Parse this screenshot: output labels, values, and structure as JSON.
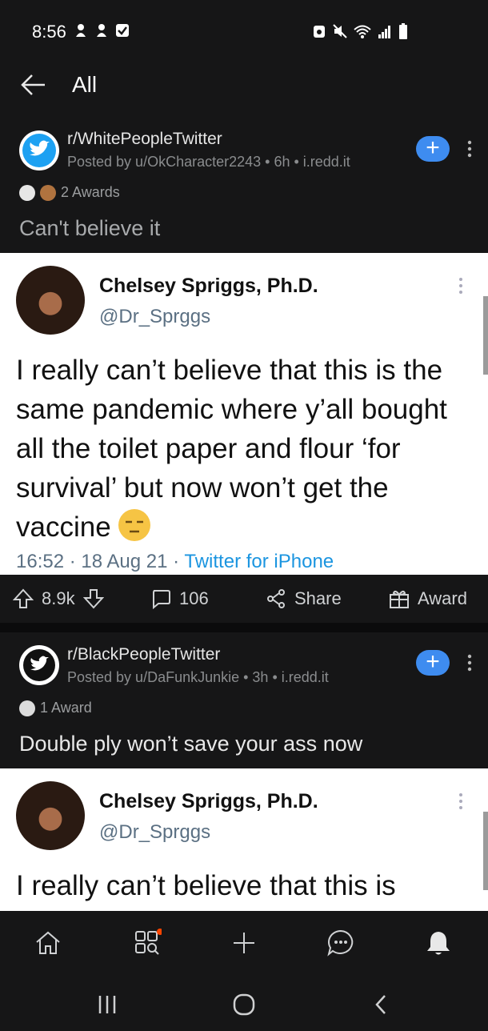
{
  "status_bar": {
    "time": "8:56",
    "left_icons": [
      "notification-app-icon",
      "notification-app-icon",
      "checkbox-notification-icon"
    ],
    "right_icons": [
      "alarm-icon",
      "mute-icon",
      "wifi-icon",
      "signal-icon",
      "battery-icon"
    ]
  },
  "top_nav": {
    "title": "All"
  },
  "posts": [
    {
      "subreddit": "r/WhitePeopleTwitter",
      "posted_by": "Posted by u/OkCharacter2243 • 6h • i.redd.it",
      "awards": "2 Awards",
      "title": "Can't believe it",
      "tweet": {
        "name": "Chelsey Spriggs, Ph.D.",
        "handle": "@Dr_Sprggs",
        "text": "I really can’t believe that this is the same pandemic where y’all bought all the toilet paper and flour ‘for survival’ but now won’t get the vaccine",
        "meta": "16:52 · 18 Aug 21 · ",
        "source": "Twitter for iPhone"
      },
      "upvotes": "8.9k",
      "comments": "106",
      "share_label": "Share",
      "award_label": "Award"
    },
    {
      "subreddit": "r/BlackPeopleTwitter",
      "posted_by": "Posted by u/DaFunkJunkie • 3h • i.redd.it",
      "awards": "1 Award",
      "title": "Double ply won’t save your ass now",
      "tweet": {
        "name": "Chelsey Spriggs, Ph.D.",
        "handle": "@Dr_Sprggs",
        "text": "I really can’t believe that this is"
      }
    }
  ],
  "bottom_nav": [
    "home-icon",
    "discover-icon",
    "create-post-icon",
    "chat-icon",
    "notifications-bell-icon"
  ],
  "system_nav": [
    "recent-apps-icon",
    "home-button-icon",
    "back-button-icon"
  ],
  "colors": {
    "accent_blue": "#3e8cf0",
    "background": "#1a1a1b",
    "link_blue": "#1b95e0"
  }
}
